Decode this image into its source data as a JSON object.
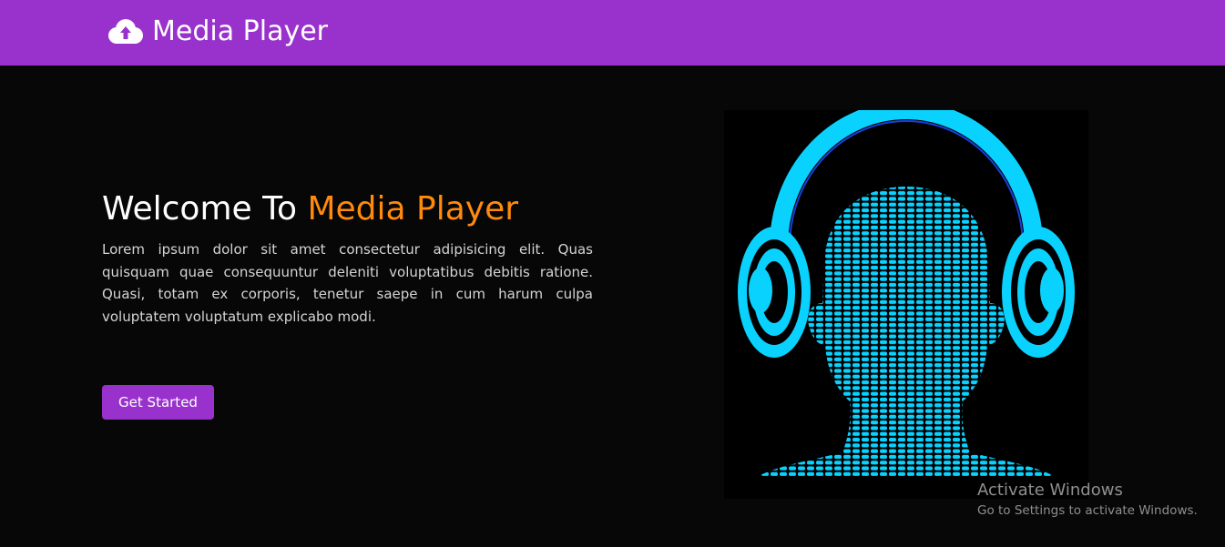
{
  "navbar": {
    "icon": "cloud-upload-icon",
    "brand": "Media Player",
    "background": "#9932cc"
  },
  "hero": {
    "title_prefix": "Welcome To ",
    "title_accent": "Media Player",
    "title_accent_color": "#ff8a0d",
    "description": "Lorem ipsum dolor sit amet consectetur adipisicing elit. Quas quisquam quae consequuntur deleniti voluptatibus debitis ratione. Quasi, totam ex corporis, tenetur saepe in cum harum culpa voluptatem voluptatum explicabo modi.",
    "cta_label": "Get Started",
    "image": "headphones-equalizer-head-illustration"
  },
  "watermark": {
    "title": "Activate Windows",
    "subtitle": "Go to Settings to activate Windows."
  },
  "colors": {
    "page_background": "#070707",
    "accent": "#9932cc",
    "illustration": "#0ad2ff"
  }
}
